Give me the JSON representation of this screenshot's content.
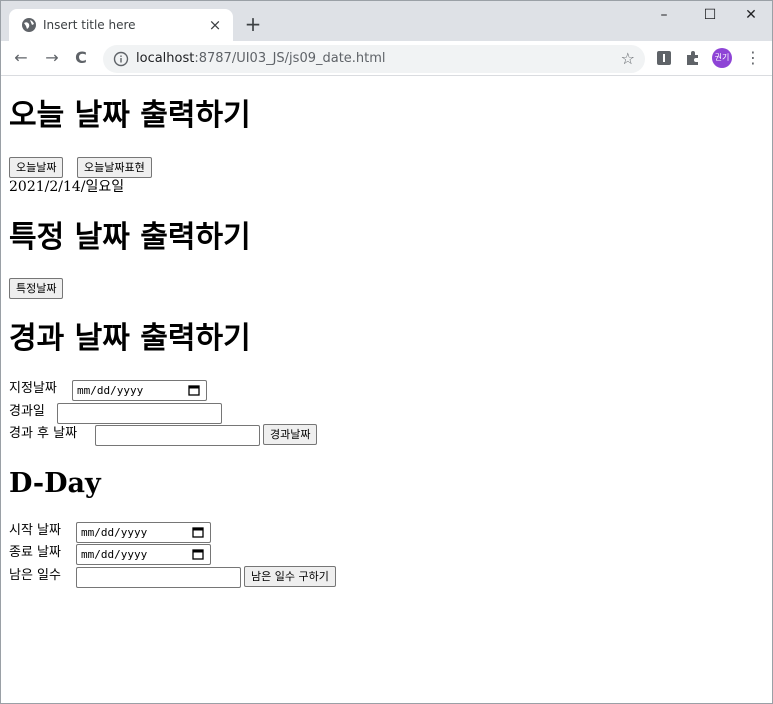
{
  "browser": {
    "tab_title": "Insert title here",
    "tab_close": "×",
    "new_tab": "+",
    "url_host": "localhost",
    "url_path": ":8787/UI03_JS/js09_date.html",
    "back": "←",
    "forward": "→",
    "reload": "C",
    "star": "☆",
    "avatar_text": "권기",
    "menu": "⋮",
    "minimize": "–",
    "maximize": "☐",
    "close": "✕"
  },
  "section1": {
    "heading": "오늘 날짜 출력하기",
    "today_button": "오늘날짜",
    "today_expr_button": "오늘날짜표현",
    "output_date": "2021/2/14/",
    "output_day": "일요일"
  },
  "section2": {
    "heading": "특정 날짜 출력하기",
    "specific_button": "특정날짜"
  },
  "section3": {
    "heading": "경과 날짜 출력하기",
    "date_label": "지정날짜",
    "date_placeholder": "mm/dd/yyyy",
    "elapsed_days_label": "경과일",
    "after_label": "경과 후 날짜",
    "elapsed_button": "경과날짜"
  },
  "section4": {
    "heading": "D-Day",
    "start_label": "시작 날짜",
    "end_label": "종료 날짜",
    "date_placeholder": "mm/dd/yyyy",
    "remain_label": "남은 일수",
    "remain_button": "남은 일수 구하기"
  },
  "colors": {
    "tabstrip": "#dee1e6",
    "avatar": "#8e44d6",
    "button_bg": "#efefef",
    "border": "#767676"
  }
}
